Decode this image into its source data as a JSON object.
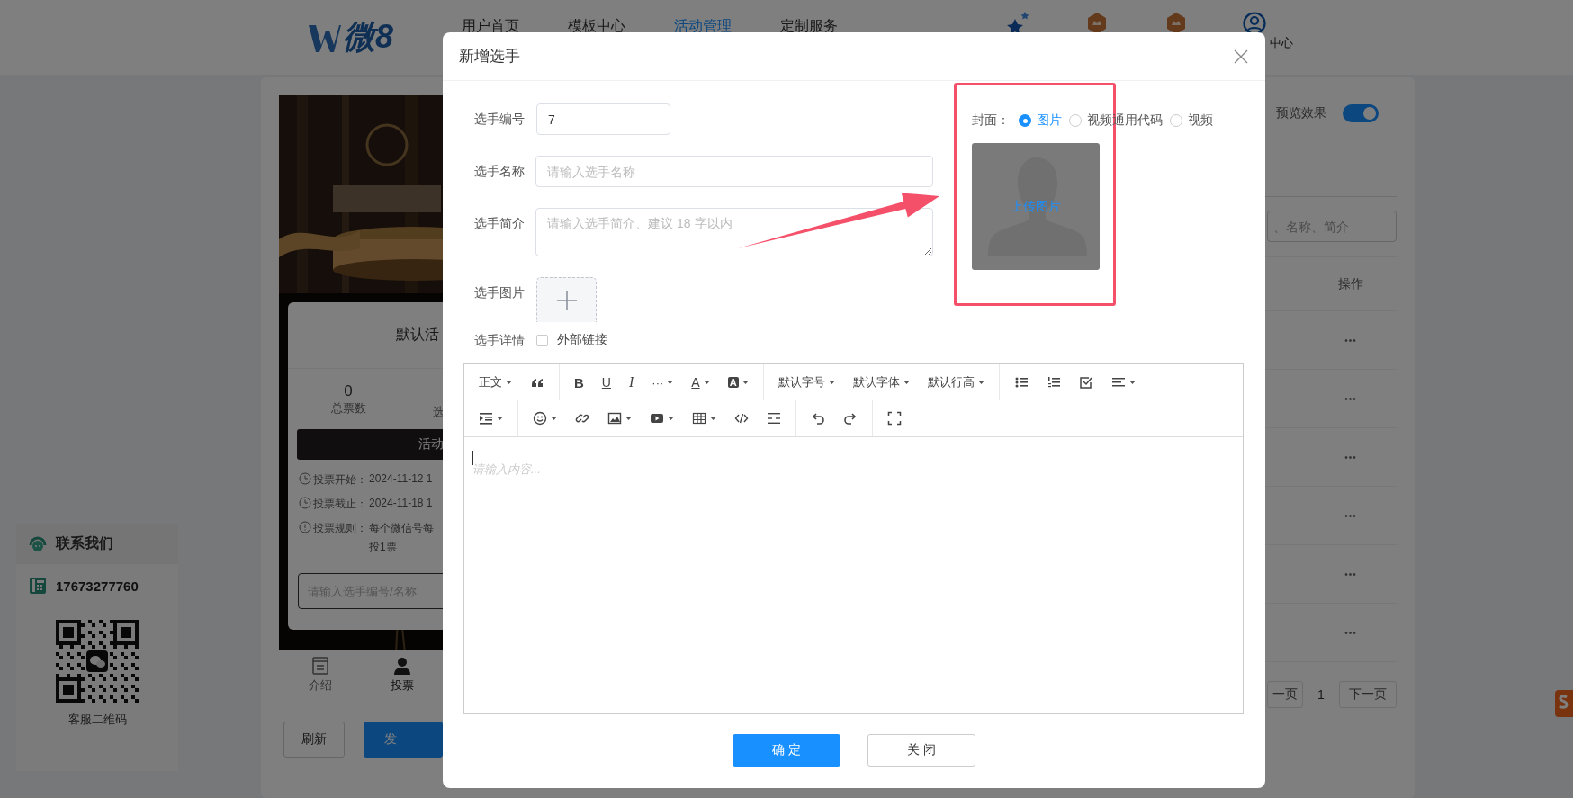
{
  "header": {
    "logo": "微8",
    "nav": [
      {
        "label": "用户首页",
        "selected": false
      },
      {
        "label": "模板中心",
        "selected": false
      },
      {
        "label": "活动管理",
        "selected": true
      },
      {
        "label": "定制服务",
        "selected": false
      }
    ],
    "user_label": "中心"
  },
  "contact": {
    "title": "联系我们",
    "phone": "17673277760",
    "qr_caption": "客服二维码"
  },
  "preview": {
    "card_title": "默认活",
    "total_votes": "0",
    "total_votes_label": "总票数",
    "stat2_label": "选",
    "action_button": "活动",
    "info": [
      {
        "kind": "clock",
        "label": "投票开始：",
        "value": "2024-11-12 1"
      },
      {
        "kind": "clock",
        "label": "投票截止：",
        "value": "2024-11-18 1"
      },
      {
        "kind": "alert",
        "label": "投票规则：",
        "value": "每个微信号每",
        "continuation": "投1票"
      }
    ],
    "search_placeholder": "请输入选手编号/名称",
    "tabs": [
      {
        "label": "介绍",
        "selected": false
      },
      {
        "label": "投票",
        "selected": true
      }
    ],
    "buttons": [
      {
        "label": "刷新",
        "kind": "default"
      },
      {
        "label": "发",
        "kind": "primary"
      }
    ]
  },
  "list_panel": {
    "preview_toggle": {
      "label": "预览效果",
      "on": true
    },
    "search_placeholder": "、名称、简介",
    "columns": [
      "操作"
    ],
    "rows": [
      {
        "action": "•••"
      },
      {
        "action": "•••"
      },
      {
        "action": "•••"
      },
      {
        "action": "•••"
      },
      {
        "action": "•••"
      },
      {
        "action": "•••"
      }
    ],
    "pagination": {
      "prev": "一页",
      "page": "1",
      "next": "下一页"
    }
  },
  "modal": {
    "title": "新增选手",
    "fields": [
      {
        "kind": "input",
        "label": "选手编号",
        "value": "7"
      },
      {
        "kind": "input",
        "label": "选手名称",
        "placeholder": "请输入选手名称"
      },
      {
        "kind": "textarea",
        "label": "选手简介",
        "placeholder": "请输入选手简介、建议 18 字以内"
      },
      {
        "kind": "upload",
        "label": "选手图片"
      },
      {
        "kind": "checkbox",
        "label": "选手详情",
        "option": "外部链接",
        "checked": false
      }
    ],
    "cover": {
      "label": "封面：",
      "options": [
        {
          "label": "图片",
          "selected": true
        },
        {
          "label": "视频通用代码",
          "selected": false
        },
        {
          "label": "视频",
          "selected": false
        }
      ],
      "upload_label": "上传图片"
    },
    "editor": {
      "toolbar": [
        [
          [
            {
              "kind": "text",
              "label": "正文",
              "dropdown": true
            },
            {
              "kind": "icon",
              "dropdown": false
            }
          ],
          [
            {
              "kind": "bold",
              "label": "B",
              "dropdown": false
            },
            {
              "kind": "underline",
              "label": "U",
              "dropdown": false
            },
            {
              "kind": "italic",
              "label": "I",
              "dropdown": false
            },
            {
              "kind": "text",
              "label": "···",
              "dropdown": true
            },
            {
              "kind": "fontcolor",
              "label": "A",
              "dropdown": true
            },
            {
              "kind": "bgcolor",
              "label": "A",
              "dropdown": true
            }
          ],
          [
            {
              "kind": "text",
              "label": "默认字号",
              "dropdown": true
            },
            {
              "kind": "text",
              "label": "默认字体",
              "dropdown": true
            },
            {
              "kind": "text",
              "label": "默认行高",
              "dropdown": true
            }
          ],
          [
            {
              "kind": "icon",
              "dropdown": false
            },
            {
              "kind": "icon",
              "dropdown": false
            },
            {
              "kind": "icon",
              "dropdown": false
            },
            {
              "kind": "icon",
              "dropdown": true
            }
          ]
        ],
        [
          [
            {
              "kind": "icon",
              "dropdown": true
            }
          ],
          [
            {
              "kind": "icon",
              "dropdown": true
            },
            {
              "kind": "icon",
              "dropdown": false
            },
            {
              "kind": "icon",
              "dropdown": true
            },
            {
              "kind": "icon",
              "dropdown": true
            },
            {
              "kind": "icon",
              "dropdown": true
            },
            {
              "kind": "icon",
              "dropdown": false
            },
            {
              "kind": "icon",
              "dropdown": false
            }
          ],
          [
            {
              "kind": "icon",
              "dropdown": false
            },
            {
              "kind": "icon",
              "dropdown": false
            }
          ],
          [
            {
              "kind": "icon",
              "dropdown": false
            }
          ]
        ]
      ],
      "placeholder": "请输入内容..."
    },
    "buttons": [
      {
        "label": "确 定",
        "kind": "primary"
      },
      {
        "label": "关 闭",
        "kind": "default"
      }
    ]
  }
}
